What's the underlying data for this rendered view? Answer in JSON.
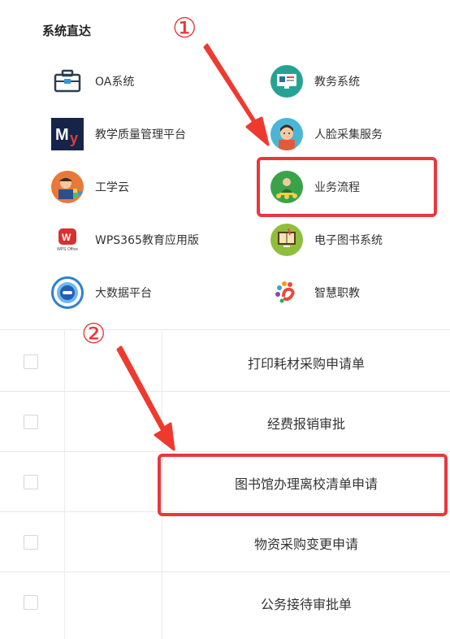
{
  "section": {
    "title": "系统直达"
  },
  "systems": [
    {
      "label": "OA系统",
      "icon": "oa-briefcase-icon"
    },
    {
      "label": "教务系统",
      "icon": "academic-affairs-icon"
    },
    {
      "label": "教学质量管理平台",
      "icon": "my-logo-icon"
    },
    {
      "label": "人脸采集服务",
      "icon": "face-capture-icon"
    },
    {
      "label": "工学云",
      "icon": "gongxueyun-icon"
    },
    {
      "label": "业务流程",
      "icon": "business-process-icon"
    },
    {
      "label": "WPS365教育应用版",
      "icon": "wps-office-icon",
      "icon_caption": "WPS Office"
    },
    {
      "label": "电子图书系统",
      "icon": "ebook-icon"
    },
    {
      "label": "大数据平台",
      "icon": "big-data-icon"
    },
    {
      "label": "智慧职教",
      "icon": "smart-vocational-icon"
    }
  ],
  "rows": [
    {
      "label": "打印耗材采购申请单"
    },
    {
      "label": "经费报销审批"
    },
    {
      "label": "图书馆办理离校清单申请"
    },
    {
      "label": "物资采购变更申请"
    },
    {
      "label": "公务接待审批单"
    }
  ],
  "annotations": {
    "step1": "①",
    "step2": "②"
  },
  "colors": {
    "highlight": "#e8383d",
    "accent_green": "#3aa34a",
    "wps_red": "#d9302e"
  }
}
